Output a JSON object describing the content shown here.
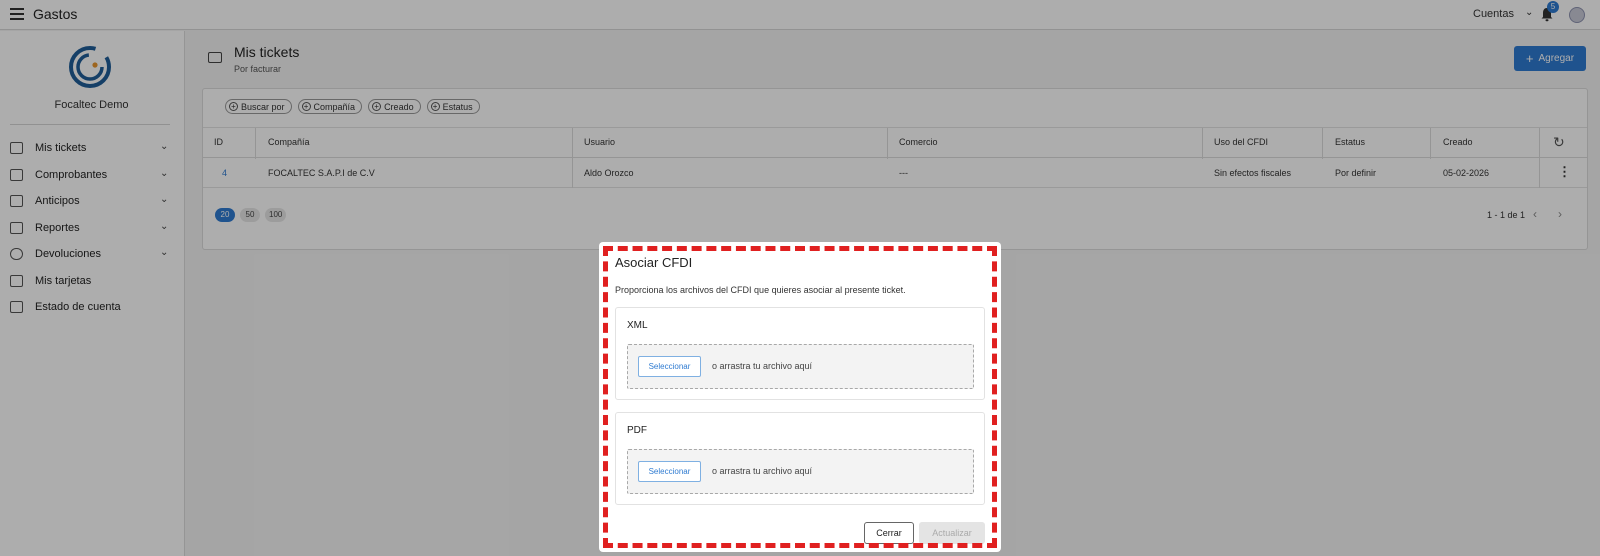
{
  "topbar": {
    "app_title": "Gastos",
    "accounts_label": "Cuentas",
    "notification_count": "5"
  },
  "sidebar": {
    "company_name": "Focaltec Demo",
    "items": [
      {
        "label": "Mis tickets",
        "icon": "receipt-icon",
        "expandable": true
      },
      {
        "label": "Comprobantes",
        "icon": "document-icon",
        "expandable": true
      },
      {
        "label": "Anticipos",
        "icon": "cash-icon",
        "expandable": true
      },
      {
        "label": "Reportes",
        "icon": "report-icon",
        "expandable": true
      },
      {
        "label": "Devoluciones",
        "icon": "refund-icon",
        "expandable": true
      },
      {
        "label": "Mis tarjetas",
        "icon": "card-icon",
        "expandable": false
      },
      {
        "label": "Estado de cuenta",
        "icon": "statement-icon",
        "expandable": false
      }
    ]
  },
  "page": {
    "title": "Mis tickets",
    "subtitle": "Por facturar",
    "add_button": "Agregar"
  },
  "filters": [
    "Buscar por",
    "Compañía",
    "Creado",
    "Estatus"
  ],
  "table": {
    "headers": [
      "ID",
      "Compañía",
      "Usuario",
      "Comercio",
      "Uso del CFDI",
      "Estatus",
      "Creado"
    ],
    "rows": [
      [
        "4",
        "FOCALTEC S.A.P.I de C.V",
        "Aldo Orozco",
        "---",
        "Sin efectos fiscales",
        "Por definir",
        "05-02-2026"
      ]
    ]
  },
  "pagination": {
    "page_sizes": [
      "20",
      "50",
      "100"
    ],
    "selected_size": "20",
    "info": "1 - 1 de 1"
  },
  "modal": {
    "title": "Asociar CFDI",
    "description": "Proporciona los archivos del CFDI que quieres asociar al presente ticket.",
    "xml": {
      "title": "XML",
      "select_label": "Seleccionar",
      "drop_text": "o arrastra tu archivo aquí"
    },
    "pdf": {
      "title": "PDF",
      "select_label": "Seleccionar",
      "drop_text": "o arrastra tu archivo aquí"
    },
    "close_button": "Cerrar",
    "update_button": "Actualizar"
  },
  "colors": {
    "accent": "#2f7bd1",
    "highlight": "#e02020"
  }
}
